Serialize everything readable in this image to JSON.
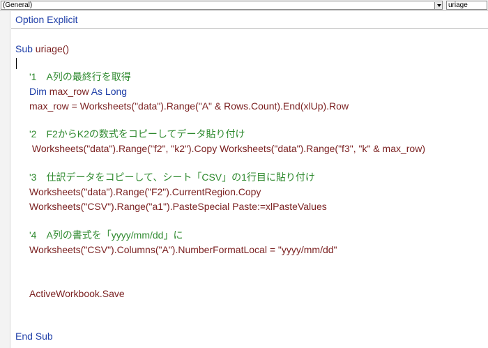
{
  "toolbar": {
    "object_combo": "(General)",
    "procedure_combo": "uriage"
  },
  "code": {
    "l1": {
      "kw": "Option Explicit"
    },
    "l2": {
      "kw": "Sub",
      "rest": " uriage()"
    },
    "l3": {
      "cm": "'1　A列の最終行を取得"
    },
    "l4": {
      "kw1": "Dim",
      "mid": " max_row ",
      "kw2": "As Long"
    },
    "l5": {
      "text": "max_row = Worksheets(\"data\").Range(\"A\" & Rows.Count).End(xlUp).Row"
    },
    "l6": {
      "cm": "'2　F2からK2の数式をコピーしてデータ貼り付け"
    },
    "l7": {
      "text": " Worksheets(\"data\").Range(\"f2\", \"k2\").Copy Worksheets(\"data\").Range(\"f3\", \"k\" & max_row)"
    },
    "l8": {
      "cm": "'3　仕訳データをコピーして、シート「CSV」の1行目に貼り付け"
    },
    "l9": {
      "text": "Worksheets(\"data\").Range(\"F2\").CurrentRegion.Copy"
    },
    "l10": {
      "text": "Worksheets(\"CSV\").Range(\"a1\").PasteSpecial Paste:=xlPasteValues"
    },
    "l11": {
      "cm": "'4　A列の書式を「yyyy/mm/dd」に"
    },
    "l12": {
      "text": "Worksheets(\"CSV\").Columns(\"A\").NumberFormatLocal = \"yyyy/mm/dd\""
    },
    "l13": {
      "text": "ActiveWorkbook.Save"
    },
    "l14": {
      "kw": "End Sub"
    }
  },
  "colors": {
    "keyword": "#1f3fa8",
    "comment": "#2f8a2f",
    "identifier": "#7a1f1f"
  }
}
